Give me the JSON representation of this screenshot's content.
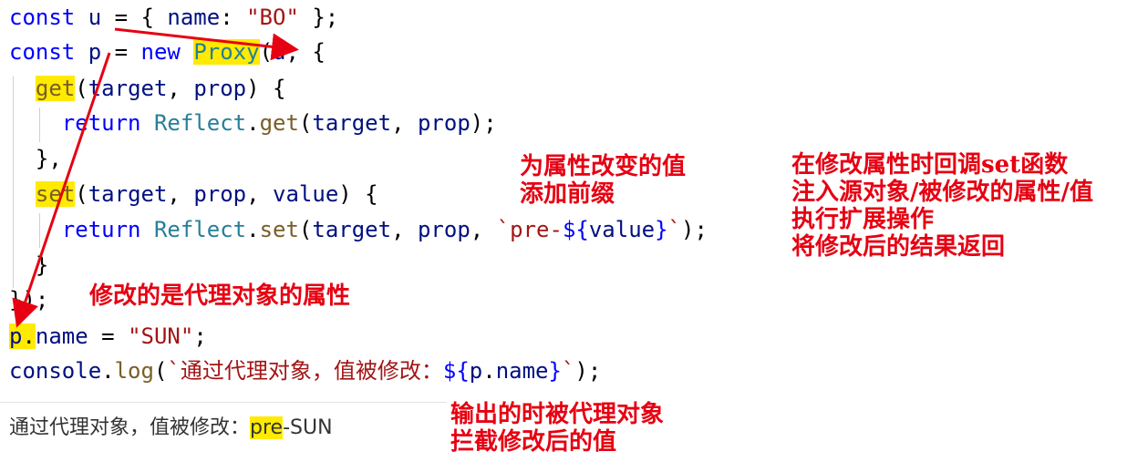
{
  "code_lines": [
    {
      "parts": [
        {
          "t": "const",
          "c": "kw"
        },
        {
          "t": " ",
          "c": "p"
        },
        {
          "t": "u",
          "c": "var"
        },
        {
          "t": " = { ",
          "c": "p"
        },
        {
          "t": "name",
          "c": "var"
        },
        {
          "t": ": ",
          "c": "p"
        },
        {
          "t": "\"BO\"",
          "c": "str"
        },
        {
          "t": " };",
          "c": "p"
        }
      ]
    },
    {
      "parts": [
        {
          "t": "const",
          "c": "kw"
        },
        {
          "t": " ",
          "c": "p"
        },
        {
          "t": "p",
          "c": "var"
        },
        {
          "t": " = ",
          "c": "p"
        },
        {
          "t": "new",
          "c": "kw"
        },
        {
          "t": " ",
          "c": "p"
        },
        {
          "t": "Proxy",
          "c": "cls hl"
        },
        {
          "t": "(",
          "c": "p"
        },
        {
          "t": "u",
          "c": "var"
        },
        {
          "t": ", {",
          "c": "p"
        }
      ]
    },
    {
      "parts": [
        {
          "t": "  ",
          "c": "p"
        },
        {
          "t": "get",
          "c": "fn hl"
        },
        {
          "t": "(",
          "c": "p"
        },
        {
          "t": "target",
          "c": "var"
        },
        {
          "t": ", ",
          "c": "p"
        },
        {
          "t": "prop",
          "c": "var"
        },
        {
          "t": ") {",
          "c": "p"
        }
      ]
    },
    {
      "parts": [
        {
          "t": "    ",
          "c": "p"
        },
        {
          "t": "return",
          "c": "kw"
        },
        {
          "t": " ",
          "c": "p"
        },
        {
          "t": "Reflect",
          "c": "cls"
        },
        {
          "t": ".",
          "c": "p"
        },
        {
          "t": "get",
          "c": "fn"
        },
        {
          "t": "(",
          "c": "p"
        },
        {
          "t": "target",
          "c": "var"
        },
        {
          "t": ", ",
          "c": "p"
        },
        {
          "t": "prop",
          "c": "var"
        },
        {
          "t": ");",
          "c": "p"
        }
      ]
    },
    {
      "parts": [
        {
          "t": "  },",
          "c": "p"
        }
      ]
    },
    {
      "parts": [
        {
          "t": "  ",
          "c": "p"
        },
        {
          "t": "set",
          "c": "fn hl"
        },
        {
          "t": "(",
          "c": "p"
        },
        {
          "t": "target",
          "c": "var"
        },
        {
          "t": ", ",
          "c": "p"
        },
        {
          "t": "prop",
          "c": "var"
        },
        {
          "t": ", ",
          "c": "p"
        },
        {
          "t": "value",
          "c": "var"
        },
        {
          "t": ") {",
          "c": "p"
        }
      ]
    },
    {
      "parts": [
        {
          "t": "    ",
          "c": "p"
        },
        {
          "t": "return",
          "c": "kw"
        },
        {
          "t": " ",
          "c": "p"
        },
        {
          "t": "Reflect",
          "c": "cls"
        },
        {
          "t": ".",
          "c": "p"
        },
        {
          "t": "set",
          "c": "fn"
        },
        {
          "t": "(",
          "c": "p"
        },
        {
          "t": "target",
          "c": "var"
        },
        {
          "t": ", ",
          "c": "p"
        },
        {
          "t": "prop",
          "c": "var"
        },
        {
          "t": ", ",
          "c": "p"
        },
        {
          "t": "`pre-",
          "c": "str"
        },
        {
          "t": "${",
          "c": "kw"
        },
        {
          "t": "value",
          "c": "var"
        },
        {
          "t": "}",
          "c": "kw"
        },
        {
          "t": "`",
          "c": "str"
        },
        {
          "t": ");",
          "c": "p"
        }
      ]
    },
    {
      "parts": [
        {
          "t": "  }",
          "c": "p"
        }
      ]
    },
    {
      "parts": [
        {
          "t": "});",
          "c": "p"
        }
      ]
    },
    {
      "parts": [
        {
          "t": "p",
          "c": "var hl"
        },
        {
          "t": ".",
          "c": "p hl"
        },
        {
          "t": "name",
          "c": "var"
        },
        {
          "t": " = ",
          "c": "p"
        },
        {
          "t": "\"SUN\"",
          "c": "str"
        },
        {
          "t": ";",
          "c": "p"
        }
      ]
    },
    {
      "parts": [
        {
          "t": "console",
          "c": "var"
        },
        {
          "t": ".",
          "c": "p"
        },
        {
          "t": "log",
          "c": "fn"
        },
        {
          "t": "(",
          "c": "p"
        },
        {
          "t": "`通过代理对象，值被修改：",
          "c": "str"
        },
        {
          "t": "${",
          "c": "kw"
        },
        {
          "t": "p",
          "c": "var"
        },
        {
          "t": ".",
          "c": "p"
        },
        {
          "t": "name",
          "c": "var"
        },
        {
          "t": "}",
          "c": "kw"
        },
        {
          "t": "`",
          "c": "str"
        },
        {
          "t": ");",
          "c": "p"
        }
      ]
    }
  ],
  "output": {
    "prefix": "通过代理对象，值被修改：",
    "highlight": "pre",
    "suffix": "-SUN"
  },
  "annotations": {
    "set_note": [
      "为属性改变的值",
      "添加前缀"
    ],
    "callback_note": [
      "在修改属性时回调set函数",
      "注入源对象/被修改的属性/值",
      "执行扩展操作",
      "将修改后的结果返回"
    ],
    "proxy_note": "修改的是代理对象的属性",
    "output_note": [
      "输出的时被代理对象",
      "拦截修改后的值"
    ]
  },
  "colors": {
    "highlight": "#ffea00",
    "annotation": "#e60012",
    "keyword": "#0000ff",
    "variable": "#001080",
    "string": "#a31515",
    "function": "#795e26",
    "class": "#267f99"
  }
}
